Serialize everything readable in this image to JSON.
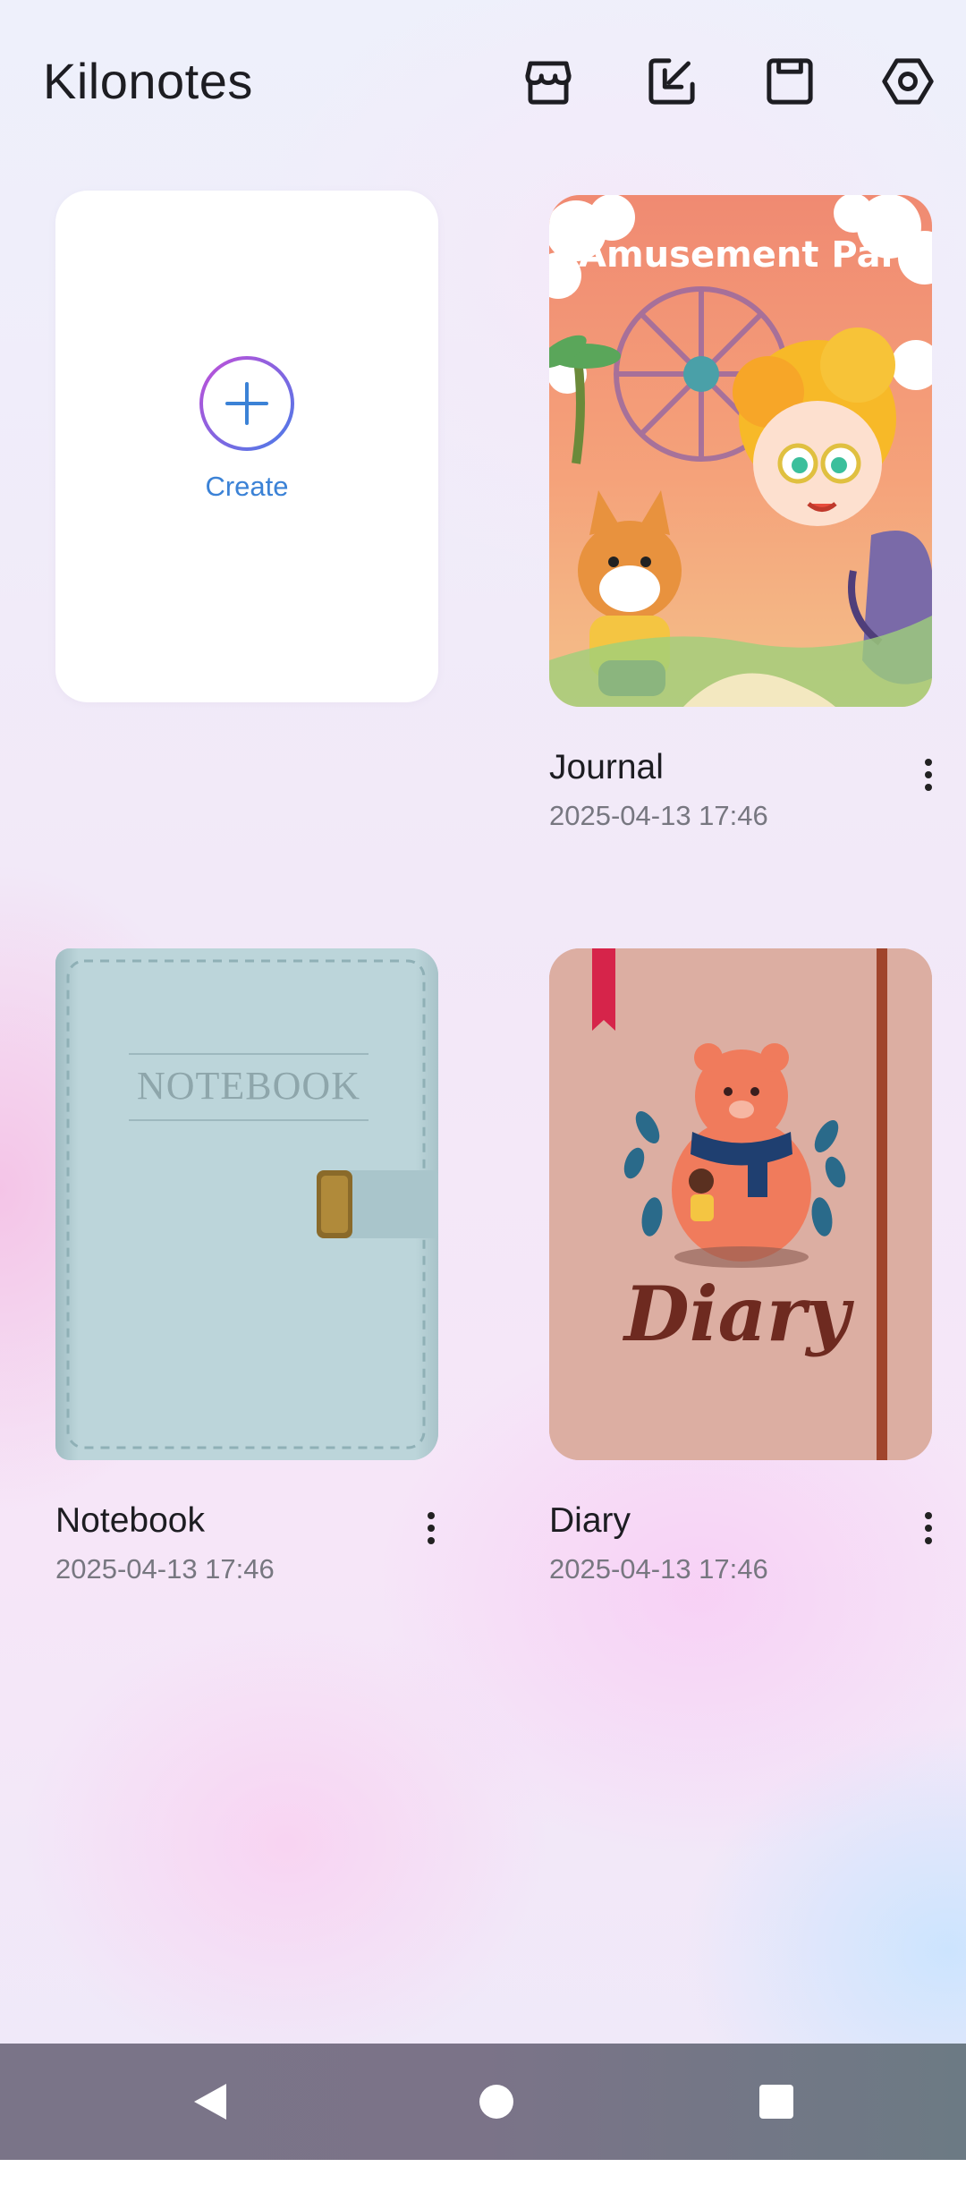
{
  "header": {
    "title": "Kilonotes",
    "icons": [
      "store-icon",
      "import-icon",
      "save-icon",
      "settings-icon"
    ]
  },
  "create": {
    "label": "Create"
  },
  "books": [
    {
      "title": "Journal",
      "date": "2025-04-13 17:46",
      "cover_text": "Amusement Park"
    },
    {
      "title": "Notebook",
      "date": "2025-04-13 17:46",
      "cover_text": "NOTEBOOK"
    },
    {
      "title": "Diary",
      "date": "2025-04-13 17:46",
      "cover_text": "Diary"
    }
  ],
  "colors": {
    "accent": "#3b82d6",
    "create_ring_start": "#c04fd8",
    "create_ring_end": "#4a7be8",
    "notebook_cover": "#bcd5da",
    "diary_cover": "#dcaea2"
  },
  "navbar": {
    "icons": [
      "back-icon",
      "home-icon",
      "recent-apps-icon"
    ]
  }
}
